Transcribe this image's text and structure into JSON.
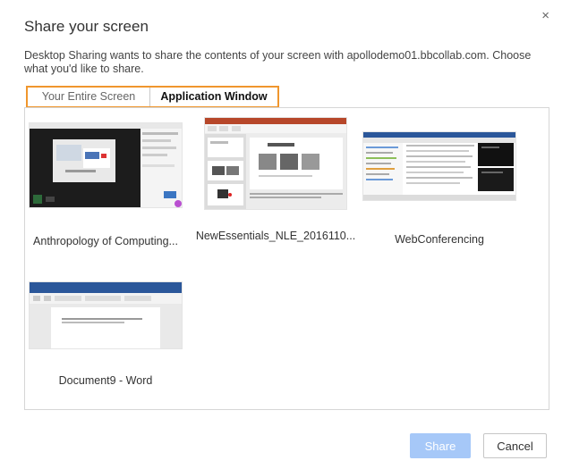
{
  "dialog": {
    "title": "Share your screen",
    "description": "Desktop Sharing wants to share the contents of your screen with apollodemo01.bbcollab.com. Choose what you'd like to share.",
    "close_glyph": "×",
    "accent_color": "#f0962d"
  },
  "tabs": [
    {
      "label": "Your Entire Screen",
      "active": false
    },
    {
      "label": "Application Window",
      "active": true
    }
  ],
  "windows": [
    {
      "label": "Anthropology of Computing..."
    },
    {
      "label": "NewEssentials_NLE_2016110..."
    },
    {
      "label": "WebConferencing"
    },
    {
      "label": "Document9 - Word"
    }
  ],
  "buttons": {
    "share": "Share",
    "cancel": "Cancel",
    "share_color": "#a6c8f8"
  }
}
